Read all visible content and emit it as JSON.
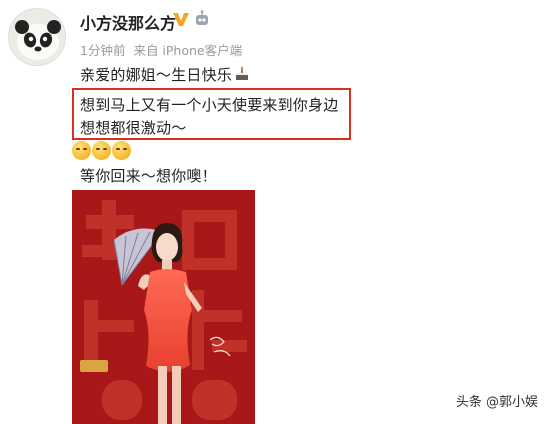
{
  "post": {
    "username": "小方没那么方",
    "time": "1分钟前",
    "source": "来自 iPhone客户端",
    "lines": {
      "line1": "亲爱的娜姐～生日快乐",
      "line2": "想到马上又有一个小天使要来到你身边",
      "line3": "想想都很激动～",
      "line4": "等你回来～想你噢！"
    }
  },
  "badges": {
    "verified_icon": "v-badge-icon",
    "robot_icon": "robot-icon",
    "cake_icon": "cake-emoji"
  },
  "emojis": [
    "sobbing-emoji",
    "sobbing-emoji",
    "sobbing-emoji"
  ],
  "watermark": "头条 @郭小娱",
  "colors": {
    "highlight_border": "#d8301f",
    "vbadge": "#f5a623",
    "poster_red": "#b61c1c"
  }
}
